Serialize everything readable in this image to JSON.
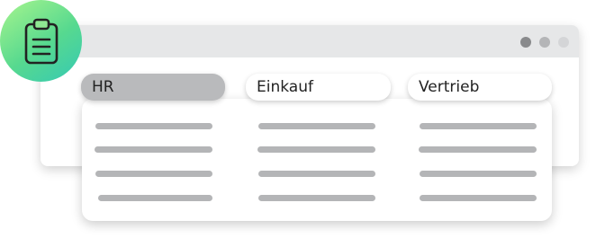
{
  "colors": {
    "window_titlebar": "#e6e7e8",
    "active_tab": "#b9babc",
    "placeholder_line": "#b4b5b7",
    "badge_gradient_start": "#a8f58e",
    "badge_gradient_end": "#35c9b4",
    "icon_stroke": "#222222"
  },
  "badge": {
    "icon": "clipboard-icon"
  },
  "window": {
    "controls": [
      "window-dot",
      "window-dot",
      "window-dot"
    ]
  },
  "tabs": [
    {
      "label": "HR",
      "active": true
    },
    {
      "label": "Einkauf",
      "active": false
    },
    {
      "label": "Vertrieb",
      "active": false
    }
  ],
  "panel": {
    "columns": 3,
    "rows_per_column": 4
  }
}
